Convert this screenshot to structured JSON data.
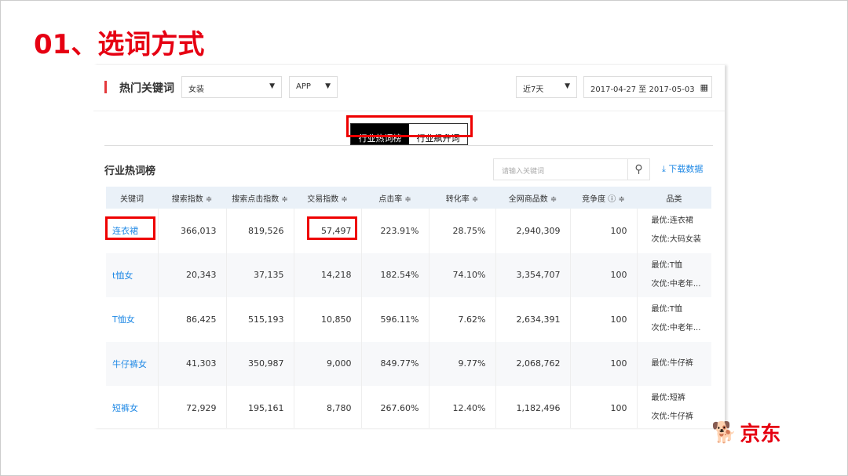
{
  "slide_title": "01、选词方式",
  "panel": {
    "title": "热门关键词",
    "category": "女装",
    "platform": "APP",
    "period": "近7天",
    "date_range": "2017-04-27 至 2017-05-03"
  },
  "tabs": [
    {
      "label": "行业热词榜",
      "active": true
    },
    {
      "label": "行业飙升词",
      "active": false
    }
  ],
  "section_title": "行业热词榜",
  "search_placeholder": "请输入关键词",
  "download_label": "下载数据",
  "columns": [
    "关键词",
    "搜索指数 ≑",
    "搜索点击指数 ≑",
    "交易指数 ≑",
    "点击率 ≑",
    "转化率 ≑",
    "全网商品数 ≑",
    "竞争度 ⓘ ≑",
    "品类"
  ],
  "rows": [
    [
      "连衣裙",
      "366,013",
      "819,526",
      "57,497",
      "223.91%",
      "28.75%",
      "2,940,309",
      "100",
      "最优:连衣裙",
      "次优:大码女装"
    ],
    [
      "t恤女",
      "20,343",
      "37,135",
      "14,218",
      "182.54%",
      "74.10%",
      "3,354,707",
      "100",
      "最优:T恤",
      "次优:中老年..."
    ],
    [
      "T恤女",
      "86,425",
      "515,193",
      "10,850",
      "596.11%",
      "7.62%",
      "2,634,391",
      "100",
      "最优:T恤",
      "次优:中老年..."
    ],
    [
      "牛仔裤女",
      "41,303",
      "350,987",
      "9,000",
      "849.77%",
      "9.77%",
      "2,068,762",
      "100",
      "最优:牛仔裤",
      ""
    ],
    [
      "短裤女",
      "72,929",
      "195,161",
      "8,780",
      "267.60%",
      "12.40%",
      "1,182,496",
      "100",
      "最优:短裤",
      "次优:牛仔裤"
    ]
  ],
  "logo_text": "京东",
  "colors": {
    "accent": "#e60012",
    "link": "#1e88e5",
    "highlight_box": "#ee0000"
  }
}
